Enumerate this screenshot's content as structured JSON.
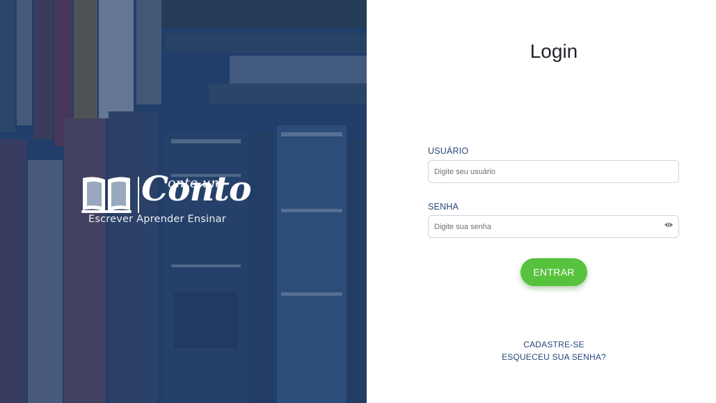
{
  "brand": {
    "name_small": "onte um",
    "name_big": "Conto",
    "tagline": "Escrever Aprender Ensinar"
  },
  "login": {
    "title": "Login",
    "username_label": "USUÁRIO",
    "username_placeholder": "Digite seu usuário",
    "password_label": "SENHA",
    "password_placeholder": "Digite sua senha",
    "submit_label": "ENTRAR",
    "register_link": "CADASTRE-SE",
    "forgot_link": "ESQUECEU SUA SENHA?"
  },
  "colors": {
    "overlay": "#1f3e6c",
    "label": "#24477a",
    "button": "#57c23d"
  },
  "icons": {
    "password_toggle": "eye-icon",
    "logo": "open-book-icon"
  }
}
